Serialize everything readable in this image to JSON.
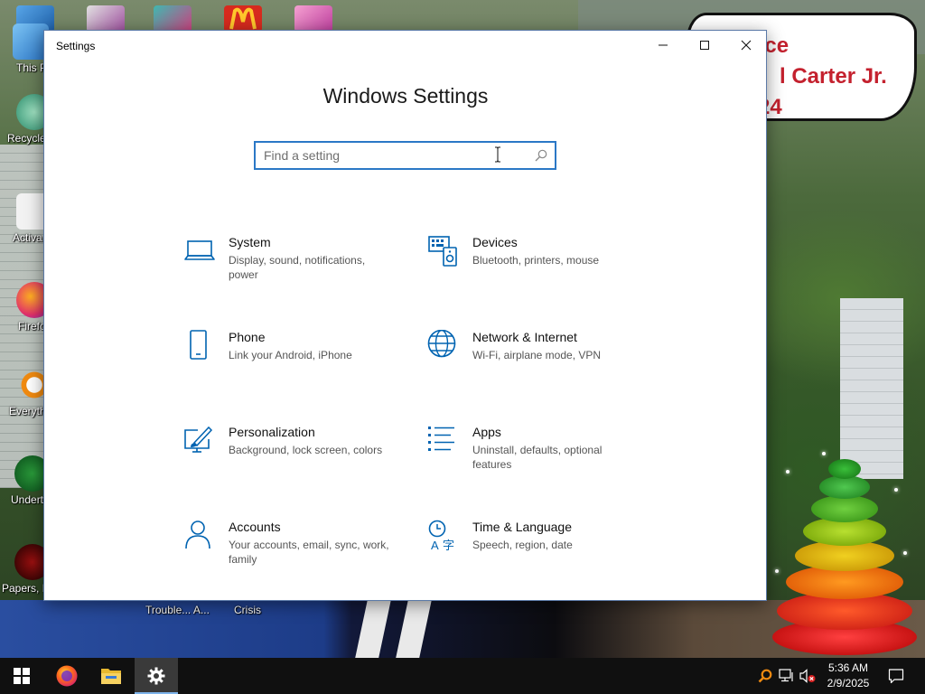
{
  "desktop": {
    "bubble_lines": [
      "ace",
      "l Carter Jr.",
      "24"
    ],
    "icons_left": [
      {
        "label": "This P"
      },
      {
        "label": "Recycle"
      },
      {
        "label": "Activa"
      },
      {
        "label": "Firefo"
      },
      {
        "label": "Everyth"
      },
      {
        "label": "Underta"
      },
      {
        "label": "Papers, P"
      }
    ],
    "bottom_labels": [
      "Trouble... A...",
      "Crisis"
    ]
  },
  "window": {
    "title": "Settings",
    "heading": "Windows Settings",
    "search_placeholder": "Find a setting",
    "categories": [
      {
        "name": "System",
        "desc": "Display, sound, notifications, power",
        "icon": "laptop-icon"
      },
      {
        "name": "Devices",
        "desc": "Bluetooth, printers, mouse",
        "icon": "devices-icon"
      },
      {
        "name": "Phone",
        "desc": "Link your Android, iPhone",
        "icon": "phone-icon"
      },
      {
        "name": "Network & Internet",
        "desc": "Wi-Fi, airplane mode, VPN",
        "icon": "globe-icon"
      },
      {
        "name": "Personalization",
        "desc": "Background, lock screen, colors",
        "icon": "paint-icon"
      },
      {
        "name": "Apps",
        "desc": "Uninstall, defaults, optional features",
        "icon": "apps-list-icon"
      },
      {
        "name": "Accounts",
        "desc": "Your accounts, email, sync, work, family",
        "icon": "person-icon"
      },
      {
        "name": "Time & Language",
        "desc": "Speech, region, date",
        "icon": "time-language-icon"
      }
    ]
  },
  "taskbar": {
    "time": "5:36 AM",
    "date": "2/9/2025"
  },
  "colors": {
    "accent": "#0063b1",
    "search_border": "#2b78c6",
    "taskbar": "#101010"
  }
}
